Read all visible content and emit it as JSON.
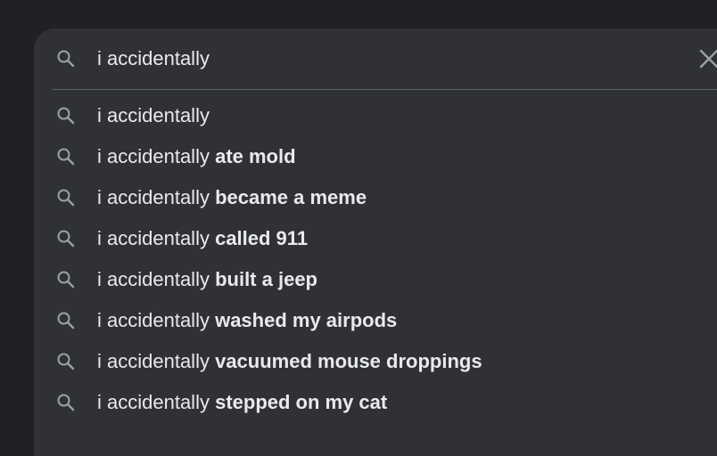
{
  "search": {
    "query": "i accidentally",
    "clear_icon": "close-icon",
    "search_icon": "search-icon"
  },
  "suggestions": [
    {
      "prefix": "i accidentally",
      "completion": ""
    },
    {
      "prefix": "i accidentally",
      "completion": "ate mold"
    },
    {
      "prefix": "i accidentally",
      "completion": "became a meme"
    },
    {
      "prefix": "i accidentally",
      "completion": "called 911"
    },
    {
      "prefix": "i accidentally",
      "completion": "built a jeep"
    },
    {
      "prefix": "i accidentally",
      "completion": "washed my airpods"
    },
    {
      "prefix": "i accidentally",
      "completion": "vacuumed mouse droppings"
    },
    {
      "prefix": "i accidentally",
      "completion": "stepped on my cat"
    }
  ],
  "colors": {
    "page_background": "#202124",
    "panel_background": "#303134",
    "text": "#e8eaed",
    "icon": "#9aa0a6",
    "divider": "#5f6368"
  }
}
